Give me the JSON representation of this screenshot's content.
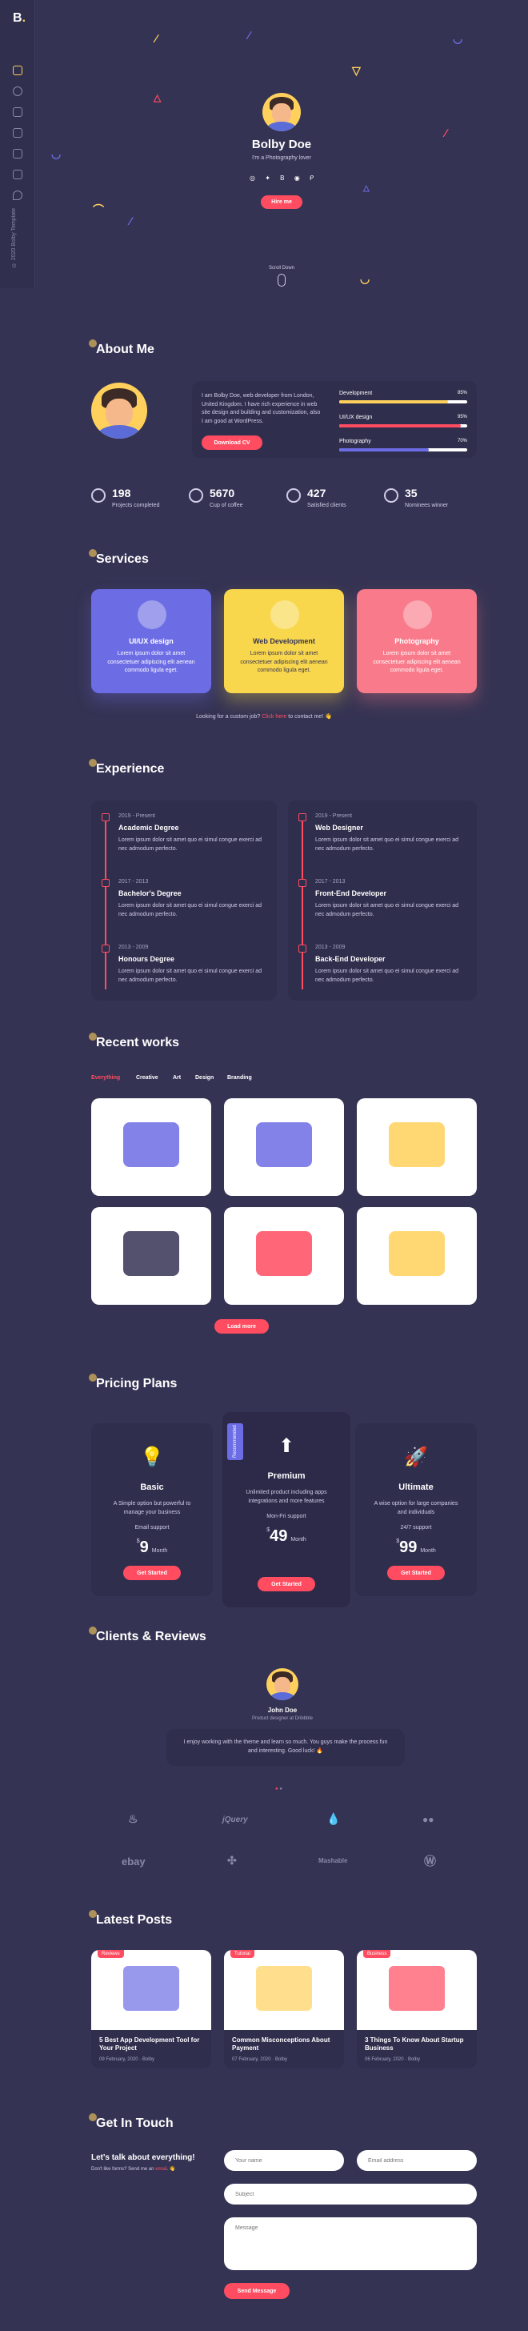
{
  "sidebar": {
    "logo": "B",
    "copyright": "© 2020 Bolby Template"
  },
  "hero": {
    "name": "Bolby Doe",
    "tagline": "I'm a Photography lover",
    "hire_label": "Hire me",
    "scroll_label": "Scroll Down"
  },
  "about": {
    "title": "About Me",
    "bio": "I am Bolby Doe, web developer from London, United Kingdom. I have rich experience in web site design and building and customization, also I am good at WordPress.",
    "download_label": "Download CV",
    "skills": [
      {
        "name": "Development",
        "percent": "85%",
        "value": 0.85,
        "color": "#ffd15c"
      },
      {
        "name": "UI/UX design",
        "percent": "95%",
        "value": 0.95,
        "color": "#ff4c60"
      },
      {
        "name": "Photography",
        "percent": "70%",
        "value": 0.7,
        "color": "#6c6ce5"
      }
    ],
    "stats": [
      {
        "num": "198",
        "label": "Projects completed"
      },
      {
        "num": "5670",
        "label": "Cup of coffee"
      },
      {
        "num": "427",
        "label": "Satisfied clients"
      },
      {
        "num": "35",
        "label": "Nominees winner"
      }
    ]
  },
  "services": {
    "title": "Services",
    "items": [
      {
        "name": "UI/UX design",
        "desc": "Lorem ipsum dolor sit amet consectetuer adipiscing elit aenean commodo ligula eget.",
        "color": "#6c6ce5"
      },
      {
        "name": "Web Development",
        "desc": "Lorem ipsum dolor sit amet consectetuer adipiscing elit aenean commodo ligula eget.",
        "color": "#f9d74c"
      },
      {
        "name": "Photography",
        "desc": "Lorem ipsum dolor sit amet consectetuer adipiscing elit aenean commodo ligula eget.",
        "color": "#f97b8b"
      }
    ],
    "cta_prefix": "Looking for a custom job?",
    "cta_link": "Click here",
    "cta_suffix": "to contact me! 👋"
  },
  "experience": {
    "title": "Experience",
    "education": [
      {
        "date": "2019 - Present",
        "title": "Academic Degree",
        "desc": "Lorem ipsum dolor sit amet quo ei simul congue exerci ad nec admodum perfecto."
      },
      {
        "date": "2017 - 2013",
        "title": "Bachelor's Degree",
        "desc": "Lorem ipsum dolor sit amet quo ei simul congue exerci ad nec admodum perfecto."
      },
      {
        "date": "2013 - 2009",
        "title": "Honours Degree",
        "desc": "Lorem ipsum dolor sit amet quo ei simul congue exerci ad nec admodum perfecto."
      }
    ],
    "work": [
      {
        "date": "2019 - Present",
        "title": "Web Designer",
        "desc": "Lorem ipsum dolor sit amet quo ei simul congue exerci ad nec admodum perfecto."
      },
      {
        "date": "2017 - 2013",
        "title": "Front-End Developer",
        "desc": "Lorem ipsum dolor sit amet quo ei simul congue exerci ad nec admodum perfecto."
      },
      {
        "date": "2013 - 2009",
        "title": "Back-End Developer",
        "desc": "Lorem ipsum dolor sit amet quo ei simul congue exerci ad nec admodum perfecto."
      }
    ]
  },
  "works": {
    "title": "Recent works",
    "filters": [
      "Everything",
      "Creative",
      "Art",
      "Design",
      "Branding"
    ],
    "load_more": "Load more"
  },
  "pricing": {
    "title": "Pricing Plans",
    "badge": "Recommended",
    "plans": [
      {
        "name": "Basic",
        "desc": "A Simple option but powerful to manage your business",
        "support": "Email support",
        "price": "9",
        "period": "Month",
        "button": "Get Started"
      },
      {
        "name": "Premium",
        "desc": "Unlimited product including apps integrations and more features",
        "support": "Mon-Fri support",
        "price": "49",
        "period": "Month",
        "button": "Get Started"
      },
      {
        "name": "Ultimate",
        "desc": "A wise option for large companies and individuals",
        "support": "24/7 support",
        "price": "99",
        "period": "Month",
        "button": "Get Started"
      }
    ],
    "currency": "$"
  },
  "reviews": {
    "title": "Clients & Reviews",
    "name": "John Doe",
    "role": "Product designer at Dribbble",
    "quote": "I enjoy working with the theme and learn so much. You guys make the process fun and interesting. Good luck! 🔥",
    "brands": [
      "jQuery",
      "Mashable",
      "ebay"
    ]
  },
  "posts": {
    "title": "Latest Posts",
    "items": [
      {
        "tag": "Reviews",
        "title": "5 Best App Development Tool for Your Project",
        "date": "09 February, 2020",
        "author": "Bolby"
      },
      {
        "tag": "Tutorial",
        "title": "Common Misconceptions About Payment",
        "date": "07 February, 2020",
        "author": "Bolby"
      },
      {
        "tag": "Business",
        "title": "3 Things To Know About Startup Business",
        "date": "06 February, 2020",
        "author": "Bolby"
      }
    ]
  },
  "contact": {
    "title": "Get In Touch",
    "heading": "Let's talk about everything!",
    "sub_prefix": "Don't like forms? Send me an",
    "sub_link": "email",
    "sub_suffix": ". 👋",
    "name_ph": "Your name",
    "email_ph": "Email address",
    "subject_ph": "Subject",
    "message_ph": "Message",
    "send": "Send Message"
  }
}
